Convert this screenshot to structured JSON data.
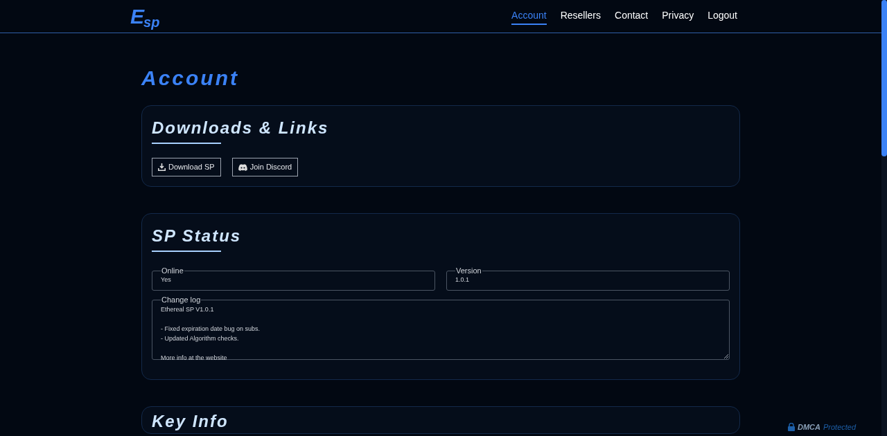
{
  "header": {
    "logo": {
      "big": "E",
      "small": "sp"
    },
    "nav": [
      {
        "label": "Account",
        "selected": true
      },
      {
        "label": "Resellers",
        "selected": false
      },
      {
        "label": "Contact",
        "selected": false
      },
      {
        "label": "Privacy",
        "selected": false
      },
      {
        "label": "Logout",
        "selected": false
      }
    ]
  },
  "page_title": "Account",
  "downloads": {
    "title": "Downloads & Links",
    "buttons": [
      {
        "kind": "download",
        "label": "Download SP"
      },
      {
        "kind": "discord",
        "label": "Join Discord"
      }
    ]
  },
  "status": {
    "title": "SP Status",
    "fields": [
      {
        "label": "Online",
        "value": "Yes"
      },
      {
        "label": "Version",
        "value": "1.0.1"
      }
    ],
    "changelog": {
      "label": "Change log",
      "paragraphs": [
        [
          "Ethereal SP V1.0.1"
        ],
        [
          "- Fixed expiration date bug on subs.",
          "- Updated Algorithm checks."
        ],
        [
          "More info at the website"
        ]
      ]
    }
  },
  "key_info": {
    "title": "Key Info"
  },
  "badge": {
    "first": "DMCA",
    "second": "Protected"
  }
}
